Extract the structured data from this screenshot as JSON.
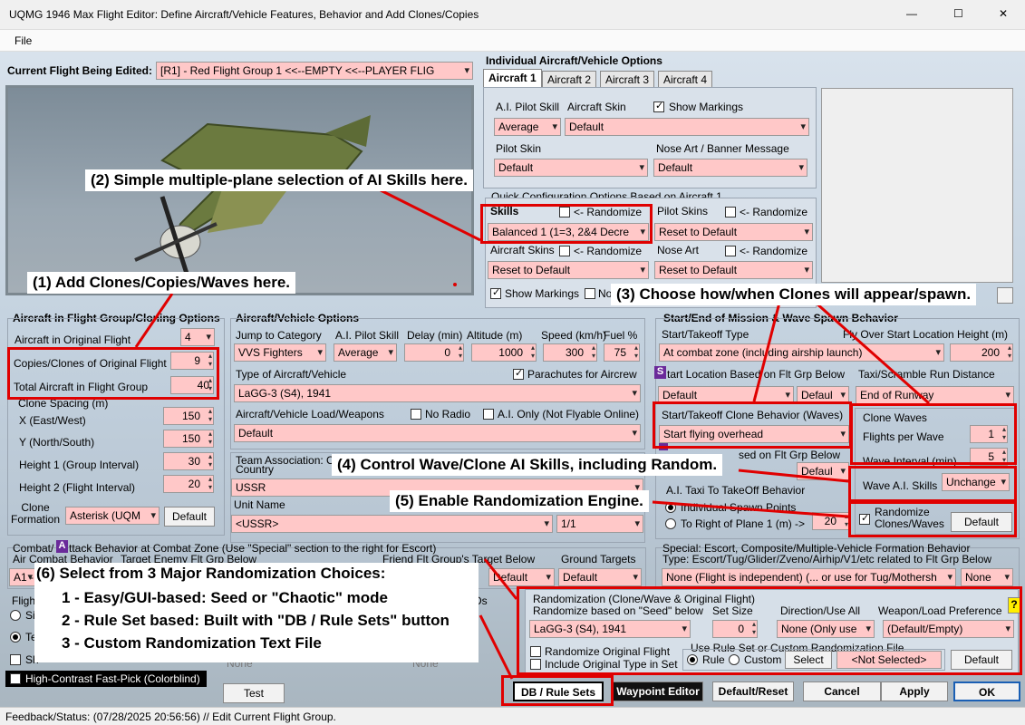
{
  "window": {
    "title": "UQMG 1946 Max Flight Editor:  Define Aircraft/Vehicle Features, Behavior and Add Clones/Copies",
    "min": "—",
    "max": "☐",
    "close": "✕"
  },
  "menu": {
    "file": "File"
  },
  "current": {
    "label": "Current Flight Being Edited:",
    "value": "[R1] -  Red Flight Group  1     <<--EMPTY     <<--PLAYER FLIG"
  },
  "indiv": {
    "title": "Individual Aircraft/Vehicle Options",
    "tabs": [
      "Aircraft 1",
      "Aircraft 2",
      "Aircraft 3",
      "Aircraft 4"
    ],
    "ai_skill_label": "A.I. Pilot Skill",
    "ai_skill": "Average",
    "skin_label": "Aircraft Skin",
    "skin": "Default",
    "show_markings": "Show Markings",
    "pilot_skin_label": "Pilot Skin",
    "pilot_skin": "Default",
    "nose_label": "Nose Art / Banner Message",
    "nose": "Default"
  },
  "quick": {
    "title": "Quick Configuration Options Based on Aircraft 1",
    "skills": "Skills",
    "randomize": "<- Randomize",
    "skills_val": "Balanced 1 (1=3, 2&4 Decre",
    "pilot_skins": "Pilot Skins",
    "pilot_skins_val": "Reset to Default",
    "aircraft_skins": "Aircraft Skins",
    "aircraft_skins_val": "Reset to Default",
    "nose_art": "Nose Art",
    "nose_art_val": "Reset to Default",
    "show_markings": "Show Markings",
    "no": "No"
  },
  "clone": {
    "title": "Aircraft in Flight Group/Cloning Options",
    "orig_label": "Aircraft in Original Flight",
    "orig": "4",
    "copies_label": "Copies/Clones of Original Flight",
    "copies": "9",
    "total_label": "Total Aircraft in Flight Group",
    "total": "40",
    "spacing": "Clone Spacing (m)",
    "x_label": "X (East/West)",
    "x": "150",
    "y_label": "Y (North/South)",
    "y": "150",
    "h1_label": "Height 1 (Group Interval)",
    "h1": "30",
    "h2_label": "Height 2 (Flight Interval)",
    "h2": "20",
    "formation_label": "Clone\nFormation",
    "formation": "Asterisk (UQM",
    "default": "Default"
  },
  "av": {
    "title": "Aircraft/Vehicle Options",
    "jump_label": "Jump to Category",
    "jump": "VVS Fighters",
    "skill_label": "A.I. Pilot Skill",
    "skill": "Average",
    "delay_label": "Delay (min)",
    "delay": "0",
    "alt_label": "Altitude (m)",
    "alt": "1000",
    "speed_label": "Speed (km/h)",
    "speed": "300",
    "fuel_label": "Fuel %",
    "fuel": "75",
    "type_label": "Type of Aircraft/Vehicle",
    "parachutes": "Parachutes for Aircrew",
    "type": "LaGG-3 (S4), 1941",
    "load_label": "Aircraft/Vehicle Load/Weapons",
    "noradio": "No Radio",
    "aionly": "A.I. Only (Not Flyable Online)",
    "load": "Default"
  },
  "team": {
    "label": "Team Association: C",
    "country_label": "Country",
    "country": "USSR",
    "unit_label": "Unit Name",
    "unit": "<USSR>",
    "frac": "1/1"
  },
  "start": {
    "title": "Start/End of Mission & Wave Spawn Behavior",
    "takeoff_label": "Start/Takeoff Type",
    "fly_label": "Fly Over Start Location Height (m)",
    "takeoff": "At combat zone (including airship launch)",
    "fly": "200",
    "s_badge": "S",
    "startloc_label": "tart Location Based on Flt Grp Below",
    "taxi_label": "Taxi/Scramble Run Distance",
    "startloc": "Default",
    "startloc2": "Defaul",
    "taxi": "End of Runway",
    "clonebeh_label": "Start/Takeoff Clone Behavior (Waves)",
    "clonebeh": "Start flying overhead",
    "sed_label": "sed on Flt Grp Below",
    "defaul2": "Defaul",
    "taxi2_label": "A.I. Taxi To TakeOff Behavior",
    "spawn1": "Individual Spawn Points",
    "spawn2": "To Right of Plane 1 (m) ->",
    "spawn_val": "20"
  },
  "waves": {
    "title": "Clone Waves",
    "fpw_label": "Flights per Wave",
    "fpw": "1",
    "wi_label": "Wave Interval (min)",
    "wi": "5",
    "wai_label": "Wave A.I. Skills",
    "wai": "Unchange",
    "rand_label": "Randomize\nClones/Waves",
    "default": "Default"
  },
  "combat": {
    "title": "Combat/",
    "a": "A",
    "title2": "ttack Behavior at Combat Zone (Use \"Special\" section to the right for Escort)",
    "acb_label": "Air Combat Behavior",
    "te_label": "Target Enemy Flt Grp Below",
    "ff_label": "Friend Flt Group's Target Below",
    "gt_label": "Ground Targets",
    "acb": "A1 -",
    "ff": "Default",
    "gt": "Default"
  },
  "special": {
    "title": "Special: Escort, Composite/Multiple-Vehicle Formation Behavior",
    "type_label": "Type: Escort/Tug/Glider/Zveno/Airhip/V1/etc related to Flt Grp Below",
    "type": "None (Flight is independent) (... or use for Tug/Mothersh",
    "none": "None"
  },
  "rand": {
    "title": "Randomization (Clone/Wave & Original Flight)",
    "seed_label": "Randomize based on \"Seed\" below",
    "set_label": "Set Size",
    "dir_label": "Direction/Use All",
    "wpn_label": "Weapon/Load Preference",
    "help": "?",
    "seed": "LaGG-3 (S4), 1941",
    "set": "0",
    "dir": "None (Only use",
    "wpn": "(Default/Empty)",
    "orig": "Randomize Original Flight",
    "inc": "Include Original Type in Set",
    "rule_label": "Use Rule Set or Custom Randomization File",
    "rule": "Rule",
    "custom": "Custom",
    "select": "Select",
    "notsel": "<Not Selected>",
    "default": "Default"
  },
  "left_bottom": {
    "flight": "Fligh",
    "si": "Si",
    "te": "Te",
    "sh": "Sh",
    "ds": "Ds",
    "hc": "High-Contrast Fast-Pick (Colorblind)",
    "none1": "None",
    "none2": "None"
  },
  "buttons": {
    "test": "Test",
    "db": "DB / Rule Sets",
    "waypoint": "Waypoint Editor",
    "defreset": "Default/Reset",
    "cancel": "Cancel",
    "apply": "Apply",
    "ok": "OK"
  },
  "status": {
    "text": "Feedback/Status:  (07/28/2025 20:56:56) // Edit Current Flight Group."
  },
  "callouts": {
    "c1": "(1) Add Clones/Copies/Waves here.",
    "c2": "(2) Simple multiple-plane selection of AI Skills here.",
    "c3": "(3) Choose how/when Clones will appear/spawn.",
    "c4": "(4) Control Wave/Clone AI Skills, including Random.",
    "c5": "(5) Enable Randomization Engine.",
    "c6_title": "(6) Select from 3 Major Randomization Choices:",
    "c6_1": "1 - Easy/GUI-based:  Seed or \"Chaotic\" mode",
    "c6_2": "2 - Rule Set based:  Built with \"DB / Rule Sets\" button",
    "c6_3": "3 - Custom Randomization Text File"
  },
  "colors": {
    "field": "#ffc8c8",
    "accent": "#e00000",
    "badge": "#6a2a9a"
  }
}
